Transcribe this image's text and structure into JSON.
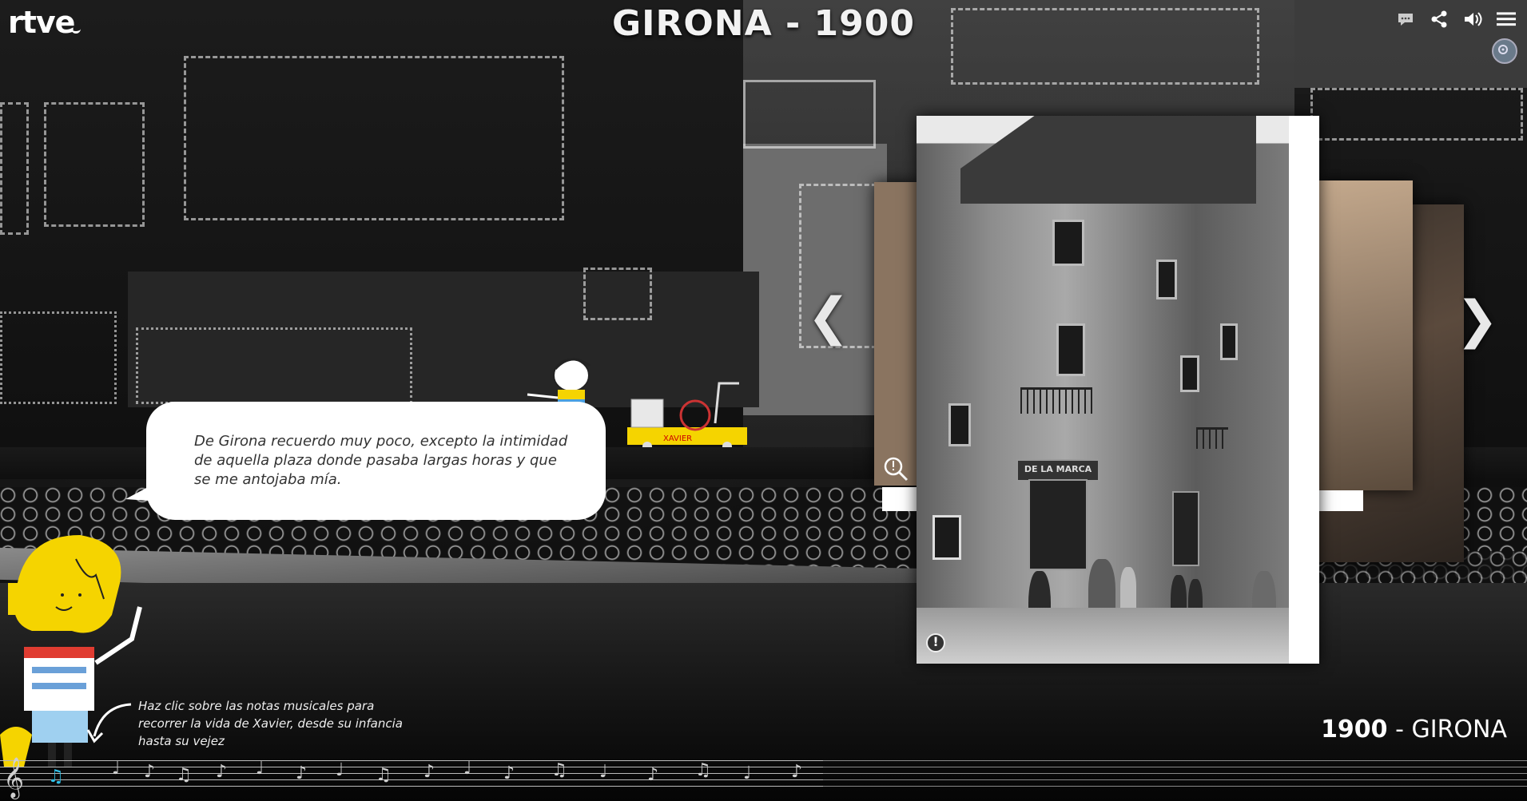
{
  "brand": {
    "logo": "rtve"
  },
  "header": {
    "title": "GIRONA - 1900"
  },
  "toolbar": {
    "comments_icon": "speech-bubble-icon",
    "share_icon": "share-icon",
    "sound_icon": "speaker-icon",
    "menu_icon": "hamburger-menu-icon",
    "focus_icon": "focus-target-icon"
  },
  "bubble": {
    "text": "De Girona recuerdo muy poco, excepto la intimidad de aquella plaza donde pasaba largas horas y que se me antojaba mía."
  },
  "cart": {
    "label": "XAVIER"
  },
  "hint": {
    "text": "Haz clic sobre las notas musicales para recorrer la vida de Xavier, desde su infancia hasta su vejez"
  },
  "location": {
    "year": "1900",
    "separator": " - ",
    "city": "GIRONA"
  },
  "photo": {
    "shop_sign": "DE LA MARCA",
    "info_icon": "!"
  },
  "nav": {
    "prev": "❮",
    "next": "❯"
  },
  "colors": {
    "accent_yellow": "#f5d400",
    "background": "#0d0d0d",
    "bubble": "#ffffff"
  }
}
